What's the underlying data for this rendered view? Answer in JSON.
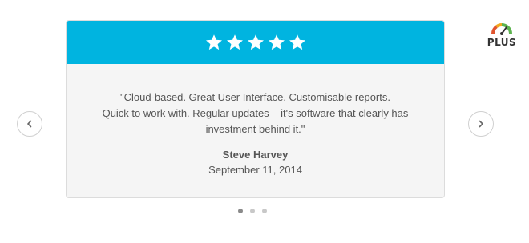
{
  "rating": {
    "stars": 5,
    "color": "#ffffff",
    "header_color": "#00b4e0"
  },
  "testimonial": {
    "quote_lines": [
      "\"Cloud-based. Great User Interface. Customisable reports.",
      "Quick to work with. Regular updates – it's software that clearly has",
      "investment behind it.\""
    ],
    "author": "Steve Harvey",
    "date": "September 11, 2014"
  },
  "navigation": {
    "prev_icon": "chevron-left-icon",
    "next_icon": "chevron-right-icon",
    "dots": {
      "count": 3,
      "active_index": 0
    }
  },
  "badge": {
    "label": "PLUS",
    "icon": "gauge-icon"
  }
}
